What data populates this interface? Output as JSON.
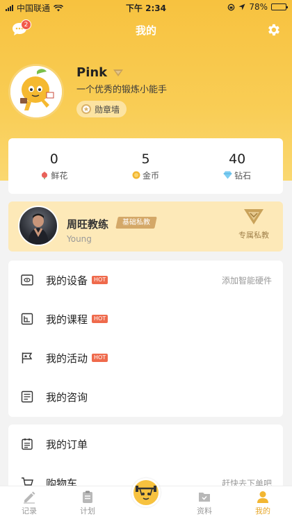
{
  "status_bar": {
    "carrier": "中国联通",
    "time": "下午 2:34",
    "battery": "78%",
    "battery_level": 0.78
  },
  "header": {
    "title": "我的",
    "message_badge": "2"
  },
  "profile": {
    "name": "Pink",
    "motto": "一个优秀的锻炼小能手",
    "medal_label": "勋章墙"
  },
  "stats": [
    {
      "value": "0",
      "label": "鲜花"
    },
    {
      "value": "5",
      "label": "金币"
    },
    {
      "value": "40",
      "label": "钻石"
    }
  ],
  "coach": {
    "name": "周旺教练",
    "tag": "基础私教",
    "subtitle": "Young",
    "private_label": "专属私教"
  },
  "menu": [
    {
      "label": "我的设备",
      "hot": "HOT",
      "right": "添加智能硬件"
    },
    {
      "label": "我的课程",
      "hot": "HOT",
      "right": ""
    },
    {
      "label": "我的活动",
      "hot": "HOT",
      "right": ""
    },
    {
      "label": "我的咨询",
      "hot": "",
      "right": ""
    }
  ],
  "menu2": [
    {
      "label": "我的订单",
      "right": ""
    },
    {
      "label": "购物车",
      "right": "赶快去下单吧"
    }
  ],
  "tabs": [
    {
      "label": "记录"
    },
    {
      "label": "计划"
    },
    {
      "label": ""
    },
    {
      "label": "资料"
    },
    {
      "label": "我的"
    }
  ],
  "colors": {
    "accent": "#f7c23f",
    "active_tab": "#e7a72a",
    "hot": "#ef6a4c"
  }
}
